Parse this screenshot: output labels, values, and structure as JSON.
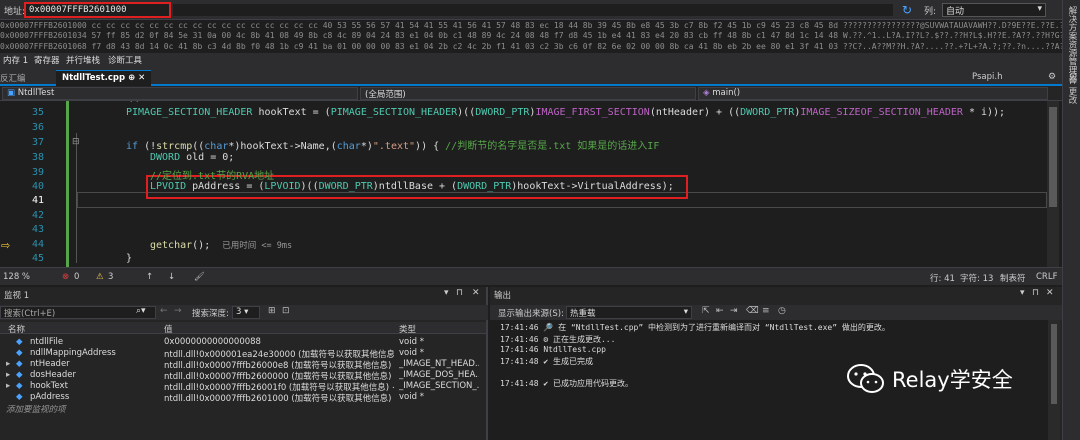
{
  "address_bar": {
    "label": "地址:",
    "value": "0x00007FFFB2601000",
    "columns_label": "列:",
    "columns_value": "自动"
  },
  "memory_rows": [
    "0x00007FFFB2601000  cc cc cc cc cc cc cc cc cc cc cc cc cc cc cc cc 40 53 55 56 57 41 54 41 55 41 56 41 57 48 83 ec 18 44 8b 39 45 8b e8 45 3b c7 8b f2 45 1b c9 45 23 c8 45 8d  ????????????????@SUVWATAUAVAWH??.D?9E??E.??E.?E#?E?",
    "0x00007FFFB2601034  57 ff 85 d2 0f 84 5e 31 0a 00 4c 8b 41 08 49 8b c8 4c 89 04 24 83 e1 04 0b c1 48 89 4c 24 08 48 f7 d8 45 1b e4 41 83 e4 20 83 cb ff 48 8b c1 47 8d 1c 14 48  W.??.^1..L?A.I??L?.$??.??H?L$.H??E.?A??.??H?G?.?H",
    "0x00007FFFB2601068  f7 d8 43 8d 14 0c 41 8b c3 4d 8b f0 48 1b c9 41 ba 01 00 00 00 83 e1 04 2b c2 4c 2b f1 41 03 c2 3b c6 0f 82 6e 02 00 00 8b ca 41 8b eb 2b ee 80 e1 3f 41 03  ??C?..A??M??H.?A?....??.+?L+?A.?;??.?n....??A??+??.?A."
  ],
  "memory_tabs": [
    "内存 1",
    "寄存器",
    "并行堆栈",
    "诊断工具"
  ],
  "right_sidebar": [
    "解决方案资源管理器",
    "Git 更改"
  ],
  "editor_tabs": {
    "other": "反汇编",
    "active": "NtdllTest.cpp",
    "psapi": "Psapi.h"
  },
  "nav_bar": {
    "project": "NtdllTest",
    "scope": "(全局范围)",
    "function": "main()"
  },
  "code_lines": [
    {
      "num": "35",
      "text": "PIMAGE_SECTION_HEADER hookText = (PIMAGE_SECTION_HEADER)((DWORD_PTR)IMAGE_FIRST_SECTION(ntHeader) + ((DWORD_PTR)IMAGE_SIZEOF_SECTION_HEADER * i));"
    },
    {
      "num": "36",
      "text": ""
    },
    {
      "num": "37",
      "text": "if (!strcmp((char*)hookText->Name,(char*)\".text\")) { //判断节的名字是否是.txt 如果是的话进入IF"
    },
    {
      "num": "38",
      "text": "DWORD old = 0;"
    },
    {
      "num": "39",
      "text": "//定位到.txt节的RVA地址"
    },
    {
      "num": "40",
      "text": "LPVOID pAddress = (LPVOID)((DWORD_PTR)ntdllBase + (DWORD_PTR)hookText->VirtualAddress);"
    },
    {
      "num": "41",
      "text": ""
    },
    {
      "num": "42",
      "text": ""
    },
    {
      "num": "43",
      "text": ""
    },
    {
      "num": "44",
      "text": "getchar();"
    },
    {
      "num": "45",
      "text": "}"
    }
  ],
  "code_hint": "已用时间 <= 9ms",
  "editor_status": {
    "zoom": "128 %",
    "errors": "0",
    "warnings": "3",
    "line": "行: 41",
    "char": "字符: 13",
    "tabs": "制表符",
    "eol": "CRLF"
  },
  "watch": {
    "title": "监视 1",
    "search_placeholder": "搜索(Ctrl+E)",
    "depth_label": "搜索深度:",
    "depth_value": "3",
    "col_name": "名称",
    "col_value": "值",
    "col_type": "类型",
    "rows": [
      {
        "expand": "",
        "name": "ntdllFile",
        "value": "0x0000000000000088",
        "type": "void *"
      },
      {
        "expand": "",
        "name": "ndllMappingAddress",
        "value": "ntdll.dll!0x000001ea24e30000 (加载符号以获取其他信息)",
        "type": "void *"
      },
      {
        "expand": "▸",
        "name": "ntHeader",
        "value": "ntdll.dll!0x00007fffb26000e8 (加载符号以获取其他信息) {Si...",
        "type": "_IMAGE_NT_HEAD..."
      },
      {
        "expand": "▸",
        "name": "dosHeader",
        "value": "ntdll.dll!0x00007fffb2600000 (加载符号以获取其他信息) {e...",
        "type": "_IMAGE_DOS_HEA..."
      },
      {
        "expand": "▸",
        "name": "hookText",
        "value": "ntdll.dll!0x00007fffb26001f0 (加载符号以获取其他信息) {N...",
        "type": "_IMAGE_SECTION_..."
      },
      {
        "expand": "",
        "name": "pAddress",
        "value": "ntdll.dll!0x00007fffb2601000 (加载符号以获取其他信息)",
        "type": "void *"
      }
    ],
    "add_item": "添加要监视的项"
  },
  "output": {
    "title": "输出",
    "source_label": "显示输出来源(S):",
    "source_value": "热重载",
    "lines": [
      "17:41:46 🔎 在 “NtdllTest.cpp” 中检测到为了进行重新编译而对 “NtdllTest.exe” 做出的更改。",
      "17:41:46 ⚙ 正在生成更改...",
      "17:41:46 NtdllTest.cpp",
      "17:41:48 ✔ 生成已完成",
      "",
      "17:41:48 ✔ 已成功应用代码更改。"
    ]
  },
  "watermark": "Relay学安全",
  "colors": {
    "accent": "#007acc",
    "highlight_border": "#e02020",
    "line_number": "#2b91af",
    "keyword": "#569cd6",
    "type": "#4ec9b0",
    "comment": "#57a64a"
  }
}
